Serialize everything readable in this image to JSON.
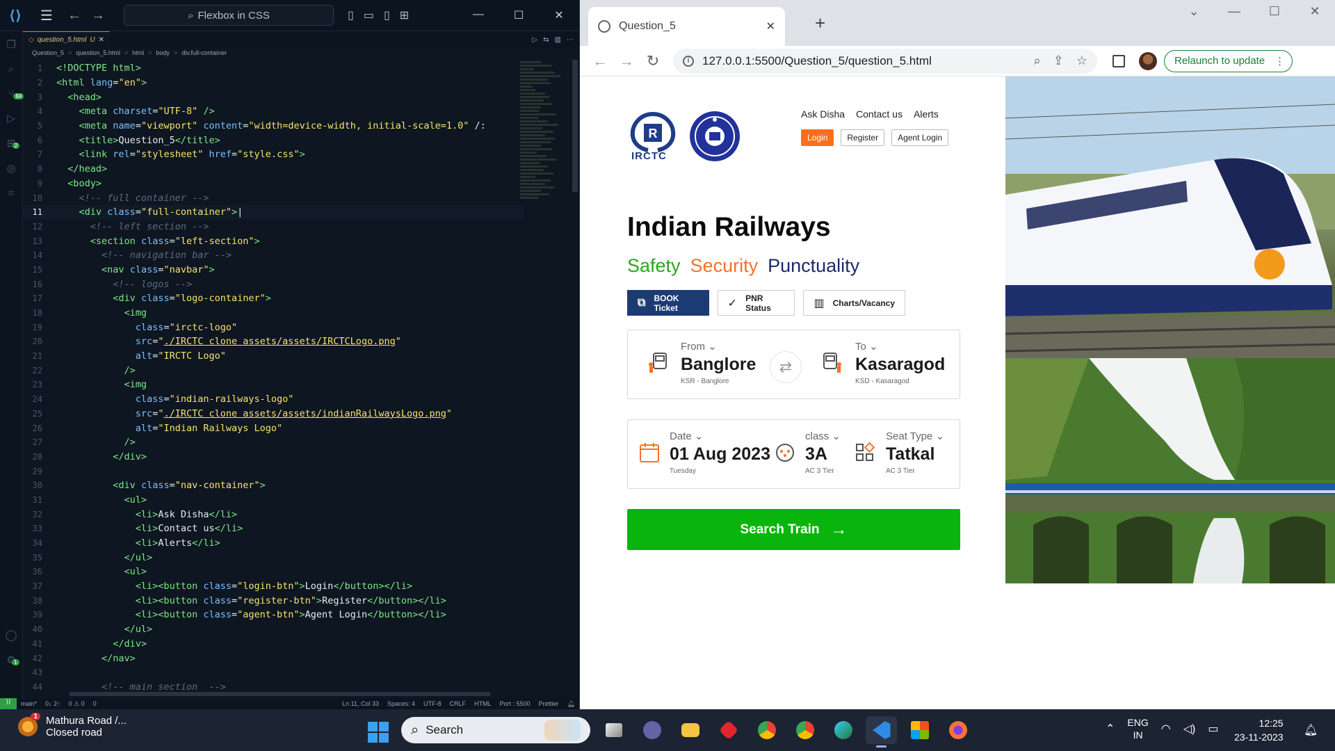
{
  "vscode": {
    "search_label": "Flexbox in CSS",
    "tab_label": "question_5.html",
    "tab_modified": "U",
    "breadcrumb": [
      "Question_5",
      "question_5.html",
      "html",
      "body",
      "div.full-container"
    ],
    "activity_badges": {
      "source_control": "84",
      "extensions": "2",
      "accounts": "1"
    },
    "status": {
      "branch": "main*",
      "sync": "0↓ 2↑",
      "problems": "0 ⚠ 0",
      "ports": "0",
      "cursor": "Ln 11, Col 33",
      "spaces": "Spaces: 4",
      "encoding": "UTF-8",
      "eol": "CRLF",
      "language": "HTML",
      "port": "Port : 5500",
      "formatter": "Prettier"
    },
    "code_lines": [
      {
        "n": "1",
        "html": "<span class='tk-tag'>&lt;!DOCTYPE html&gt;</span>"
      },
      {
        "n": "2",
        "html": "<span class='tk-tag'>&lt;html</span> <span class='tk-attr'>lang</span>=<span class='tk-str'>\"en\"</span><span class='tk-tag'>&gt;</span>"
      },
      {
        "n": "3",
        "html": "  <span class='tk-tag'>&lt;head&gt;</span>"
      },
      {
        "n": "4",
        "html": "    <span class='tk-tag'>&lt;meta</span> <span class='tk-attr'>charset</span>=<span class='tk-str'>\"UTF-8\"</span> <span class='tk-tag'>/&gt;</span>"
      },
      {
        "n": "5",
        "html": "    <span class='tk-tag'>&lt;meta</span> <span class='tk-attr'>name</span>=<span class='tk-str'>\"viewport\"</span> <span class='tk-attr'>content</span>=<span class='tk-str'>\"width=device-width, initial-scale=1.0\"</span> /:"
      },
      {
        "n": "6",
        "html": "    <span class='tk-tag'>&lt;title&gt;</span><span class='tk-txt'>Question_5</span><span class='tk-tag'>&lt;/title&gt;</span>"
      },
      {
        "n": "7",
        "html": "    <span class='tk-tag'>&lt;link</span> <span class='tk-attr'>rel</span>=<span class='tk-str'>\"stylesheet\"</span> <span class='tk-attr'>href</span>=<span class='tk-str'>\"style.css\"</span><span class='tk-tag'>&gt;</span>"
      },
      {
        "n": "8",
        "html": "  <span class='tk-tag'>&lt;/head&gt;</span>"
      },
      {
        "n": "9",
        "html": "  <span class='tk-tag'>&lt;body&gt;</span>"
      },
      {
        "n": "10",
        "html": "    <span class='tk-com'>&lt;!-- full container --&gt;</span>"
      },
      {
        "n": "11",
        "html": "    <span class='tk-tag'>&lt;div</span> <span class='tk-attr'>class</span>=<span class='tk-str'>\"full-container\"</span><span class='tk-tag'>&gt;</span>|",
        "active": true
      },
      {
        "n": "12",
        "html": "      <span class='tk-com'>&lt;!-- left section --&gt;</span>"
      },
      {
        "n": "13",
        "html": "      <span class='tk-tag'>&lt;section</span> <span class='tk-attr'>class</span>=<span class='tk-str'>\"left-section\"</span><span class='tk-tag'>&gt;</span>"
      },
      {
        "n": "14",
        "html": "        <span class='tk-com'>&lt;!-- navigation bar --&gt;</span>"
      },
      {
        "n": "15",
        "html": "        <span class='tk-tag'>&lt;nav</span> <span class='tk-attr'>class</span>=<span class='tk-str'>\"navbar\"</span><span class='tk-tag'>&gt;</span>"
      },
      {
        "n": "16",
        "html": "          <span class='tk-com'>&lt;!-- logos --&gt;</span>"
      },
      {
        "n": "17",
        "html": "          <span class='tk-tag'>&lt;div</span> <span class='tk-attr'>class</span>=<span class='tk-str'>\"logo-container\"</span><span class='tk-tag'>&gt;</span>"
      },
      {
        "n": "18",
        "html": "            <span class='tk-tag'>&lt;img</span>"
      },
      {
        "n": "19",
        "html": "              <span class='tk-attr'>class</span>=<span class='tk-str'>\"irctc-logo\"</span>"
      },
      {
        "n": "20",
        "html": "              <span class='tk-attr'>src</span>=<span class='tk-str'>\"<u>./IRCTC clone assets/assets/IRCTCLogo.png</u>\"</span>"
      },
      {
        "n": "21",
        "html": "              <span class='tk-attr'>alt</span>=<span class='tk-str'>\"IRCTC Logo\"</span>"
      },
      {
        "n": "22",
        "html": "            <span class='tk-tag'>/&gt;</span>"
      },
      {
        "n": "23",
        "html": "            <span class='tk-tag'>&lt;img</span>"
      },
      {
        "n": "24",
        "html": "              <span class='tk-attr'>class</span>=<span class='tk-str'>\"indian-railways-logo\"</span>"
      },
      {
        "n": "25",
        "html": "              <span class='tk-attr'>src</span>=<span class='tk-str'>\"<u>./IRCTC clone assets/assets/indianRailwaysLogo.png</u>\"</span>"
      },
      {
        "n": "26",
        "html": "              <span class='tk-attr'>alt</span>=<span class='tk-str'>\"Indian Railways Logo\"</span>"
      },
      {
        "n": "27",
        "html": "            <span class='tk-tag'>/&gt;</span>"
      },
      {
        "n": "28",
        "html": "          <span class='tk-tag'>&lt;/div&gt;</span>"
      },
      {
        "n": "29",
        "html": ""
      },
      {
        "n": "30",
        "html": "          <span class='tk-tag'>&lt;div</span> <span class='tk-attr'>class</span>=<span class='tk-str'>\"nav-container\"</span><span class='tk-tag'>&gt;</span>"
      },
      {
        "n": "31",
        "html": "            <span class='tk-tag'>&lt;ul&gt;</span>"
      },
      {
        "n": "32",
        "html": "              <span class='tk-tag'>&lt;li&gt;</span><span class='tk-txt'>Ask Disha</span><span class='tk-tag'>&lt;/li&gt;</span>"
      },
      {
        "n": "33",
        "html": "              <span class='tk-tag'>&lt;li&gt;</span><span class='tk-txt'>Contact us</span><span class='tk-tag'>&lt;/li&gt;</span>"
      },
      {
        "n": "34",
        "html": "              <span class='tk-tag'>&lt;li&gt;</span><span class='tk-txt'>Alerts</span><span class='tk-tag'>&lt;/li&gt;</span>"
      },
      {
        "n": "35",
        "html": "            <span class='tk-tag'>&lt;/ul&gt;</span>"
      },
      {
        "n": "36",
        "html": "            <span class='tk-tag'>&lt;ul&gt;</span>"
      },
      {
        "n": "37",
        "html": "              <span class='tk-tag'>&lt;li&gt;&lt;button</span> <span class='tk-attr'>class</span>=<span class='tk-str'>\"login-btn\"</span><span class='tk-tag'>&gt;</span><span class='tk-txt'>Login</span><span class='tk-tag'>&lt;/button&gt;&lt;/li&gt;</span>"
      },
      {
        "n": "38",
        "html": "              <span class='tk-tag'>&lt;li&gt;&lt;button</span> <span class='tk-attr'>class</span>=<span class='tk-str'>\"register-btn\"</span><span class='tk-tag'>&gt;</span><span class='tk-txt'>Register</span><span class='tk-tag'>&lt;/button&gt;&lt;/li&gt;</span>"
      },
      {
        "n": "39",
        "html": "              <span class='tk-tag'>&lt;li&gt;&lt;button</span> <span class='tk-attr'>class</span>=<span class='tk-str'>\"agent-btn\"</span><span class='tk-tag'>&gt;</span><span class='tk-txt'>Agent Login</span><span class='tk-tag'>&lt;/button&gt;&lt;/li&gt;</span>"
      },
      {
        "n": "40",
        "html": "            <span class='tk-tag'>&lt;/ul&gt;</span>"
      },
      {
        "n": "41",
        "html": "          <span class='tk-tag'>&lt;/div&gt;</span>"
      },
      {
        "n": "42",
        "html": "        <span class='tk-tag'>&lt;/nav&gt;</span>"
      },
      {
        "n": "43",
        "html": ""
      },
      {
        "n": "44",
        "html": "        <span class='tk-com'>&lt;!-- main section  --&gt;</span>"
      }
    ]
  },
  "browser": {
    "tab_title": "Question_5",
    "url": "127.0.0.1:5500/Question_5/question_5.html",
    "relaunch_label": "Relaunch to update",
    "page": {
      "nav_links": [
        "Ask Disha",
        "Contact us",
        "Alerts"
      ],
      "login": "Login",
      "register": "Register",
      "agent_login": "Agent Login",
      "irctc_logo_text": "IRCTC",
      "title": "Indian Railways",
      "tagline": {
        "a": "Safety",
        "b": "Security",
        "c": "Punctuality"
      },
      "actions": {
        "book": "BOOK Ticket",
        "pnr": "PNR Status",
        "charts": "Charts/Vacancy"
      },
      "from": {
        "label": "From",
        "value": "Banglore",
        "sub": "KSR - Banglore"
      },
      "to": {
        "label": "To",
        "value": "Kasaragod",
        "sub": "KSD - Kasaragod"
      },
      "date": {
        "label": "Date",
        "value": "01 Aug 2023",
        "sub": "Tuesday"
      },
      "class": {
        "label": "class",
        "value": "3A",
        "sub": "AC 3 Tier"
      },
      "seat": {
        "label": "Seat Type",
        "value": "Tatkal",
        "sub": "AC 3 Tier"
      },
      "search_label": "Search Train",
      "colors": {
        "login": "#f96f1d",
        "book": "#1d3b73",
        "search": "#09b50c",
        "safety": "#2aa61f",
        "security": "#f4722a",
        "punctuality": "#1d2a6b"
      }
    }
  },
  "taskbar": {
    "weather_title": "Mathura Road /...",
    "weather_sub": "Closed road",
    "weather_badge": "1",
    "search_label": "Search",
    "lang_top": "ENG",
    "lang_bottom": "IN",
    "time": "12:25",
    "date": "23-11-2023"
  }
}
